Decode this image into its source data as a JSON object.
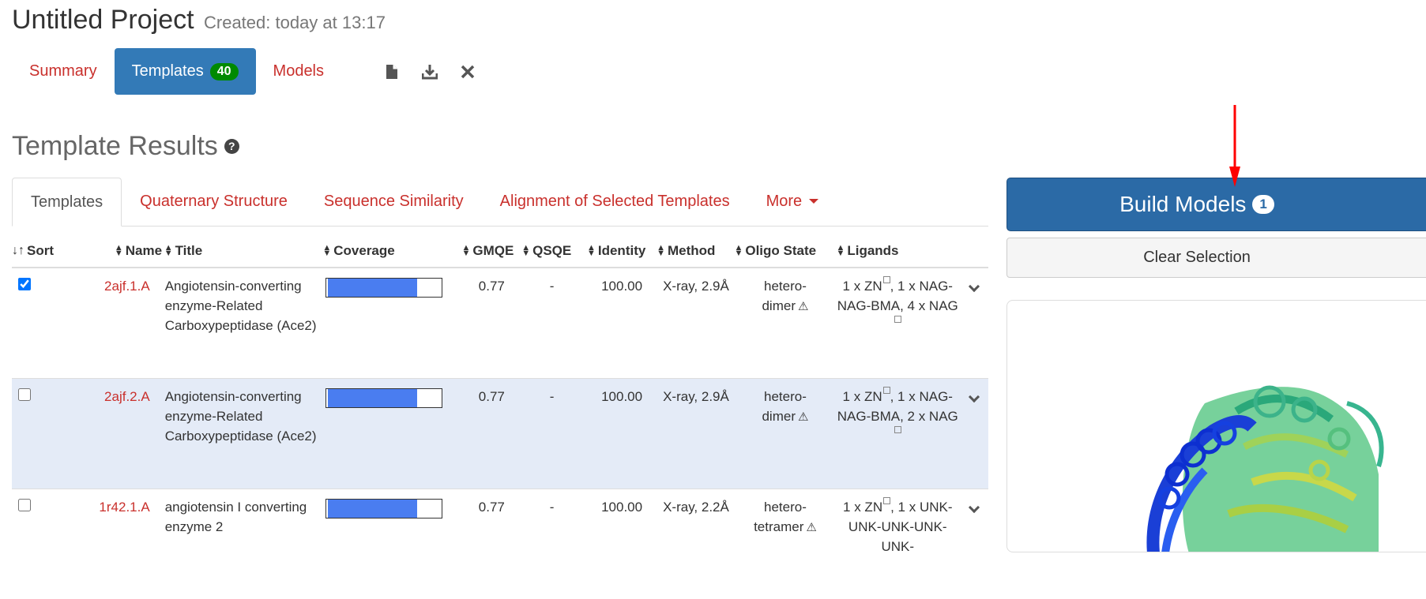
{
  "project": {
    "title": "Untitled Project",
    "created": "Created: today at 13:17"
  },
  "main_tabs": [
    {
      "label": "Summary"
    },
    {
      "label": "Templates",
      "badge": "40"
    },
    {
      "label": "Models"
    }
  ],
  "toolbar_icons": [
    "file-icon",
    "download-icon",
    "close-icon"
  ],
  "section": {
    "title": "Template Results"
  },
  "sub_tabs": [
    {
      "label": "Templates"
    },
    {
      "label": "Quaternary Structure"
    },
    {
      "label": "Sequence Similarity"
    },
    {
      "label": "Alignment of Selected Templates"
    },
    {
      "label": "More"
    }
  ],
  "table": {
    "headers": [
      "Sort",
      "Name",
      "Title",
      "Coverage",
      "GMQE",
      "QSQE",
      "Identity",
      "Method",
      "Oligo State",
      "Ligands"
    ],
    "rows": [
      {
        "checked": true,
        "name": "2ajf.1.A",
        "title": "Angiotensin-converting enzyme-Related Carboxypeptidase (Ace2)",
        "coverage": 0.77,
        "gmqe": "0.77",
        "qsqe": "-",
        "identity": "100.00",
        "method": "X-ray, 2.9Å",
        "oligo_1": "hetero-",
        "oligo_2": "dimer",
        "lig_1": "1 x ZN",
        "lig_2": ", 1 x NAG-",
        "lig_3": "NAG-BMA, 4 x NAG"
      },
      {
        "checked": false,
        "name": "2ajf.2.A",
        "title": "Angiotensin-converting enzyme-Related Carboxypeptidase (Ace2)",
        "coverage": 0.77,
        "gmqe": "0.77",
        "qsqe": "-",
        "identity": "100.00",
        "method": "X-ray, 2.9Å",
        "oligo_1": "hetero-",
        "oligo_2": "dimer",
        "lig_1": "1 x ZN",
        "lig_2": ", 1 x NAG-",
        "lig_3": "NAG-BMA, 2 x NAG"
      },
      {
        "checked": false,
        "name": "1r42.1.A",
        "title": "angiotensin I converting enzyme 2",
        "coverage": 0.77,
        "gmqe": "0.77",
        "qsqe": "-",
        "identity": "100.00",
        "method": "X-ray, 2.2Å",
        "oligo_1": "hetero-",
        "oligo_2": "tetramer",
        "lig_1": "1 x ZN",
        "lig_2": ", 1 x UNK-",
        "lig_3": "UNK-UNK-UNK-UNK-"
      }
    ]
  },
  "actions": {
    "build_label": "Build Models",
    "build_count": "1",
    "clear_label": "Clear Selection"
  },
  "colors": {
    "primary": "#337ab7",
    "link": "#c9302c",
    "badge_green": "#008a00",
    "selected_row": "#e4ebf7",
    "coverage_fill": "#4a7df0",
    "annotation_arrow": "#ff0000"
  }
}
